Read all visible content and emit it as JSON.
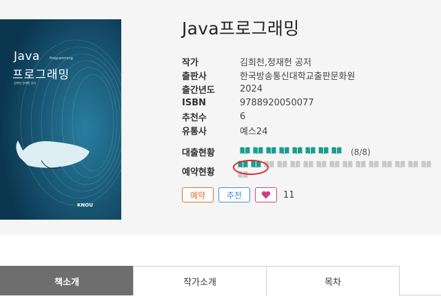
{
  "book": {
    "title": "Java프로그래밍",
    "cover": {
      "title_en": "Java",
      "subtitle_en": "Programming",
      "title_ko": "프로그래밍",
      "authors": "김희천·정재헌 공저",
      "publisher_logo": "KNOU"
    },
    "fields": [
      {
        "label": "작가",
        "value": "김희천,정재헌 공저"
      },
      {
        "label": "출판사",
        "value": "한국방송통신대학교출판문화원"
      },
      {
        "label": "출간년도",
        "value": "2024"
      },
      {
        "label": "ISBN",
        "value": "9788920050077"
      },
      {
        "label": "추천수",
        "value": "6"
      },
      {
        "label": "유통사",
        "value": "예스24"
      }
    ]
  },
  "status": {
    "loan_label": "대출현황",
    "loan_count": "(8/8)",
    "loan_available": 8,
    "loan_total": 8,
    "reserve_label": "예약현황",
    "reserve_filled": 2,
    "reserve_empty_visible": 14
  },
  "actions": {
    "reserve_label": "예약",
    "recommend_label": "추천",
    "like_count": "11"
  },
  "tabs": [
    {
      "label": "책소개",
      "active": true
    },
    {
      "label": "작가소개",
      "active": false
    },
    {
      "label": "목차",
      "active": false
    }
  ],
  "colors": {
    "book_available": "#1a9e8e",
    "book_empty": "#c8c8c8",
    "reserve_btn": "#e36b2c",
    "recommend_btn": "#3d8ae0",
    "heart": "#d04081",
    "annotation": "#e0222f"
  }
}
